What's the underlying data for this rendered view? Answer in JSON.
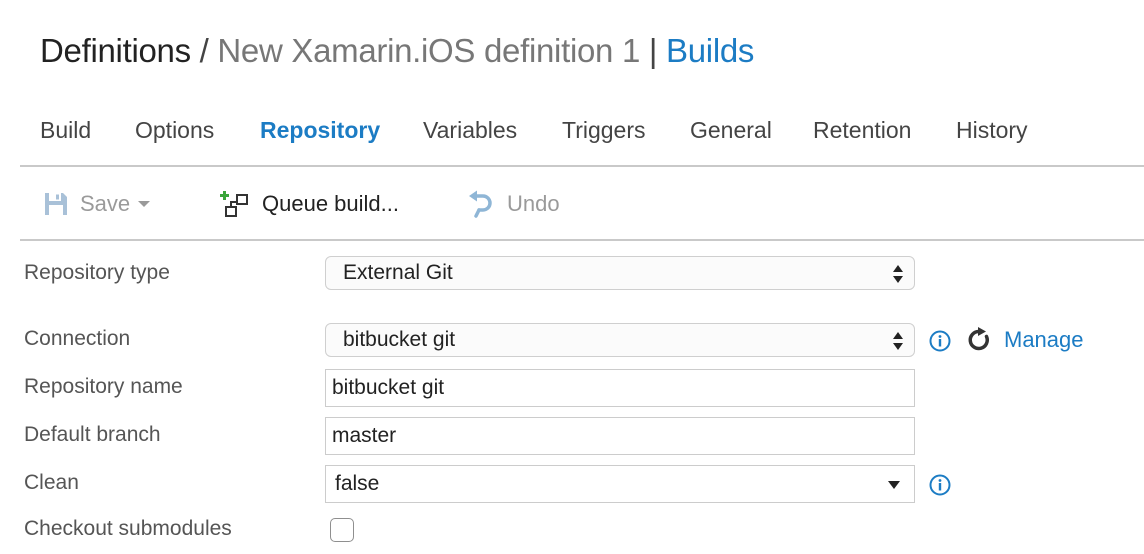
{
  "breadcrumb": {
    "root": "Definitions",
    "separator": " / ",
    "current": "New Xamarin.iOS definition 1",
    "divider": " | ",
    "link": "Builds"
  },
  "tabs": [
    "Build",
    "Options",
    "Repository",
    "Variables",
    "Triggers",
    "General",
    "Retention",
    "History"
  ],
  "active_tab": "Repository",
  "toolbar": {
    "save": "Save",
    "queue_build": "Queue build...",
    "undo": "Undo"
  },
  "form": {
    "repository_type": {
      "label": "Repository type",
      "value": "External Git"
    },
    "connection": {
      "label": "Connection",
      "value": "bitbucket git",
      "manage": "Manage"
    },
    "repository_name": {
      "label": "Repository name",
      "value": "bitbucket git"
    },
    "default_branch": {
      "label": "Default branch",
      "value": "master"
    },
    "clean": {
      "label": "Clean",
      "value": "false"
    },
    "checkout_submodules": {
      "label": "Checkout submodules",
      "checked": false
    }
  },
  "colors": {
    "accent": "#1c7cc4",
    "disabled_text": "#9a9a9a",
    "divider": "#c9c9c9",
    "queue_icon_green": "#3aa53a"
  },
  "icons": [
    "save-icon",
    "queue-build-icon",
    "undo-icon",
    "info-icon",
    "refresh-icon"
  ]
}
